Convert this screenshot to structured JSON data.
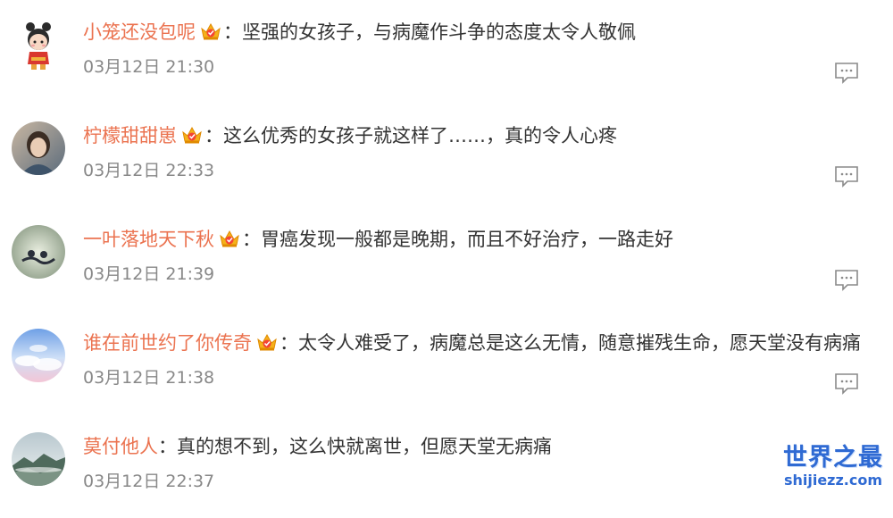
{
  "comments": [
    {
      "username": "小笼还没包呢",
      "badge_icon": "vip-crown-icon",
      "colon": "：",
      "text": "坚强的女孩子，与病魔作斗争的态度太令人敬佩",
      "time": "03月12日 21:30",
      "reply_icon": "comment-reply-icon"
    },
    {
      "username": "柠檬甜甜崽",
      "badge_icon": "vip-crown-icon",
      "colon": "：",
      "text": "这么优秀的女孩子就这样了……，真的令人心疼",
      "time": "03月12日 22:33",
      "reply_icon": "comment-reply-icon"
    },
    {
      "username": "一叶落地天下秋",
      "badge_icon": "vip-crown-icon",
      "colon": "：",
      "text": "胃癌发现一般都是晚期，而且不好治疗，一路走好",
      "time": "03月12日 21:39",
      "reply_icon": "comment-reply-icon"
    },
    {
      "username": "谁在前世约了你传奇",
      "badge_icon": "vip-crown-icon",
      "colon": "：",
      "text": "太令人难受了，病魔总是这么无情，随意摧残生命，愿天堂没有病痛",
      "time": "03月12日 21:38",
      "reply_icon": "comment-reply-icon"
    },
    {
      "username": "莫付他人",
      "colon": "：",
      "text": "真的想不到，这么快就离世，但愿天堂无病痛",
      "time": "03月12日 22:37",
      "reply_icon": "comment-reply-icon"
    }
  ],
  "watermark": {
    "title": "世界之最",
    "domain": "shijiezz.com"
  },
  "colors": {
    "username": "#eb7350",
    "text": "#333333",
    "time": "#888888",
    "watermark": "#2f6ad3"
  }
}
